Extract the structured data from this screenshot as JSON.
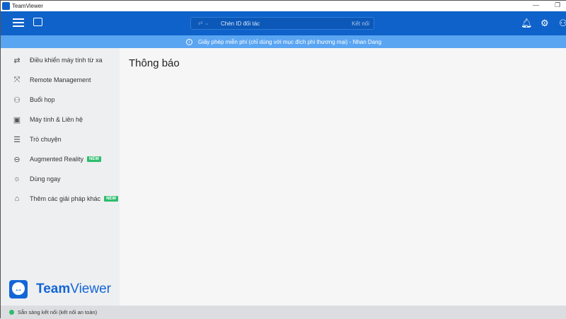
{
  "window": {
    "title": "TeamViewer",
    "minimize": "—",
    "restore": "❐"
  },
  "topbar": {
    "partner_placeholder": "Chèn ID đối tác",
    "connect_label": "Kết nối"
  },
  "banner": {
    "text": "Giấy phép miễn phí (chỉ dùng với mục đích phi thương mại) - Nhan Dang"
  },
  "sidebar": {
    "items": [
      {
        "label": "Điều khiển máy tính từ xa",
        "icon": "⇄"
      },
      {
        "label": "Remote Management",
        "icon": "⤧"
      },
      {
        "label": "Buổi họp",
        "icon": "⚇"
      },
      {
        "label": "Máy tính & Liên hệ",
        "icon": "▣"
      },
      {
        "label": "Trò chuyện",
        "icon": "☰"
      },
      {
        "label": "Augmented Reality",
        "icon": "⊖",
        "badge": "NEW"
      },
      {
        "label": "Dùng ngay",
        "icon": "☼"
      },
      {
        "label": "Thêm các giải pháp khác",
        "icon": "⌂",
        "badge": "NEW"
      }
    ]
  },
  "brand": {
    "name_bold": "Team",
    "name_rest": "Viewer"
  },
  "main": {
    "title": "Thông báo"
  },
  "status": {
    "text": "Sẵn sàng kết nối (kết nối an toàn)",
    "color": "#2dbd6e"
  }
}
